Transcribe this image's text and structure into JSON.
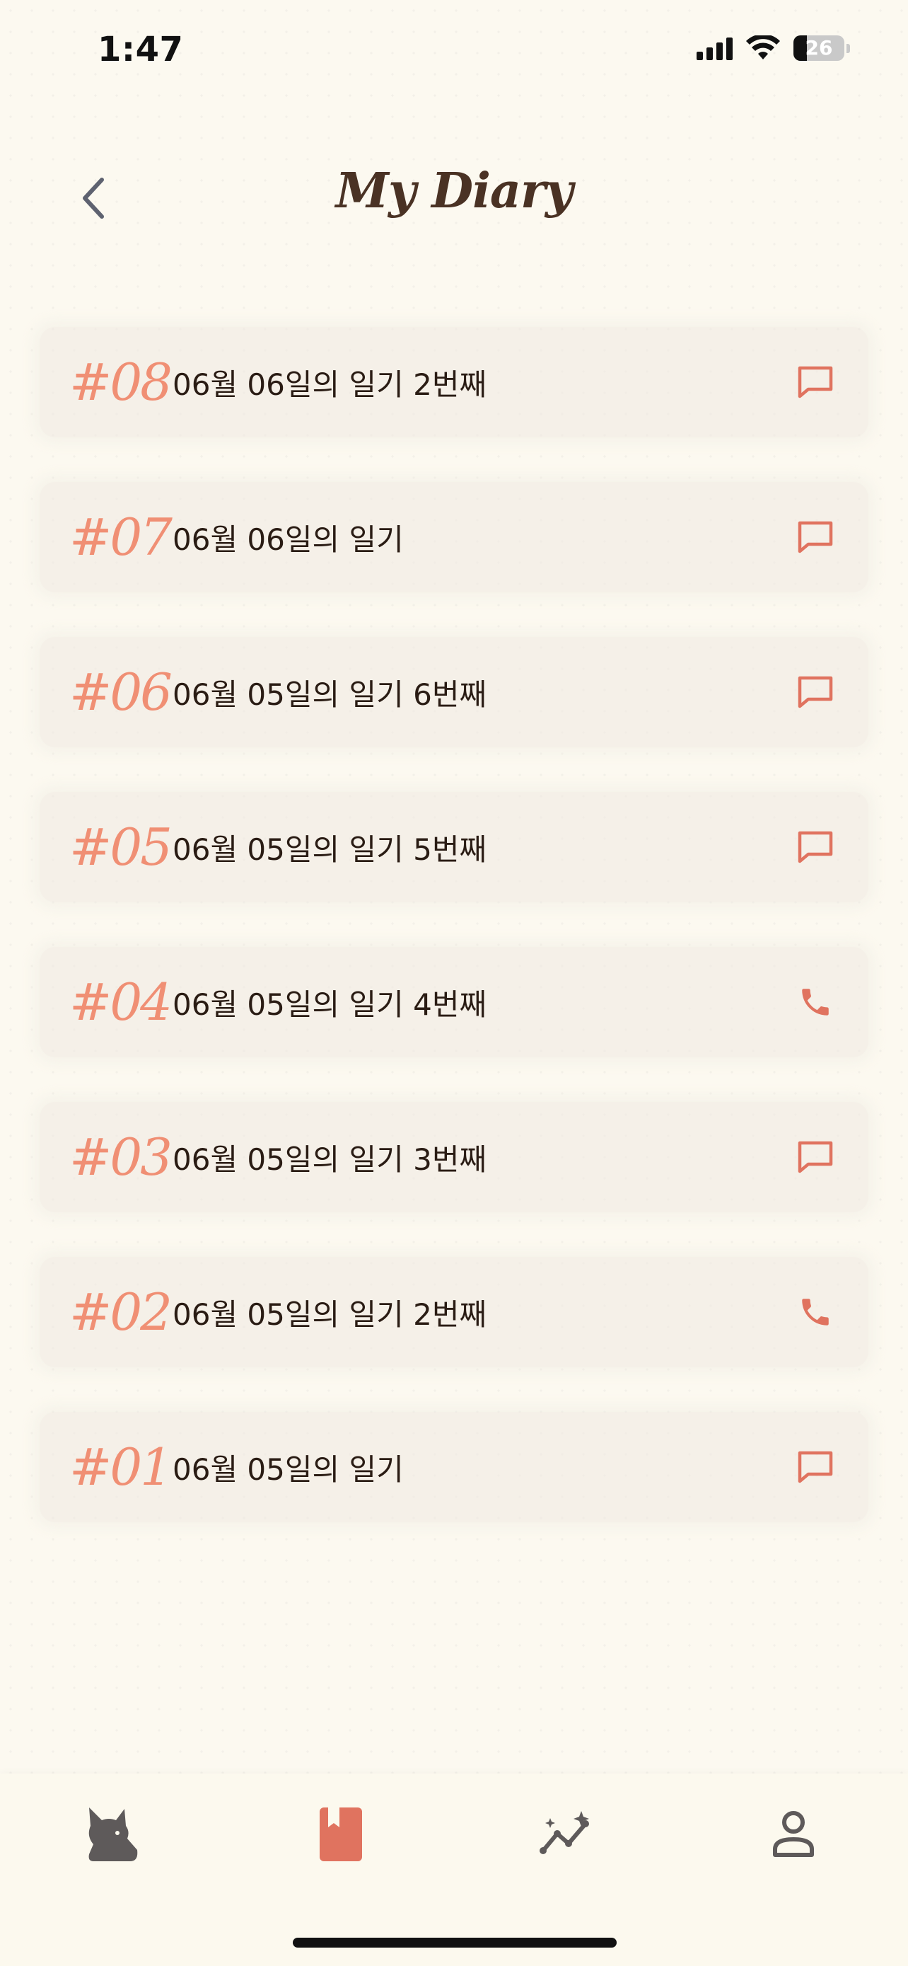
{
  "status_bar": {
    "time": "1:47",
    "battery_level": "26"
  },
  "header": {
    "title": "My Diary"
  },
  "diary_entries": [
    {
      "number": "#08",
      "title": "06월 06일의 일기 2번째",
      "type_icon": "chat-icon"
    },
    {
      "number": "#07",
      "title": "06월 06일의 일기",
      "type_icon": "chat-icon"
    },
    {
      "number": "#06",
      "title": "06월 05일의 일기 6번째",
      "type_icon": "chat-icon"
    },
    {
      "number": "#05",
      "title": "06월 05일의 일기 5번째",
      "type_icon": "chat-icon"
    },
    {
      "number": "#04",
      "title": "06월 05일의 일기 4번째",
      "type_icon": "phone-icon"
    },
    {
      "number": "#03",
      "title": "06월 05일의 일기 3번째",
      "type_icon": "chat-icon"
    },
    {
      "number": "#02",
      "title": "06월 05일의 일기 2번째",
      "type_icon": "phone-icon"
    },
    {
      "number": "#01",
      "title": "06월 05일의 일기",
      "type_icon": "chat-icon"
    }
  ],
  "tab_bar": {
    "tabs": [
      {
        "name": "home",
        "icon": "cat-icon",
        "active": false
      },
      {
        "name": "diary",
        "icon": "bookmark-book-icon",
        "active": true
      },
      {
        "name": "insights",
        "icon": "sparkle-chart-icon",
        "active": false
      },
      {
        "name": "profile",
        "icon": "person-icon",
        "active": false
      }
    ]
  },
  "colors": {
    "background": "#fcf9f0",
    "accent": "#e0735f",
    "number": "#f08f74",
    "title": "#4a3224",
    "inactive_icon": "#5e5a5a"
  }
}
